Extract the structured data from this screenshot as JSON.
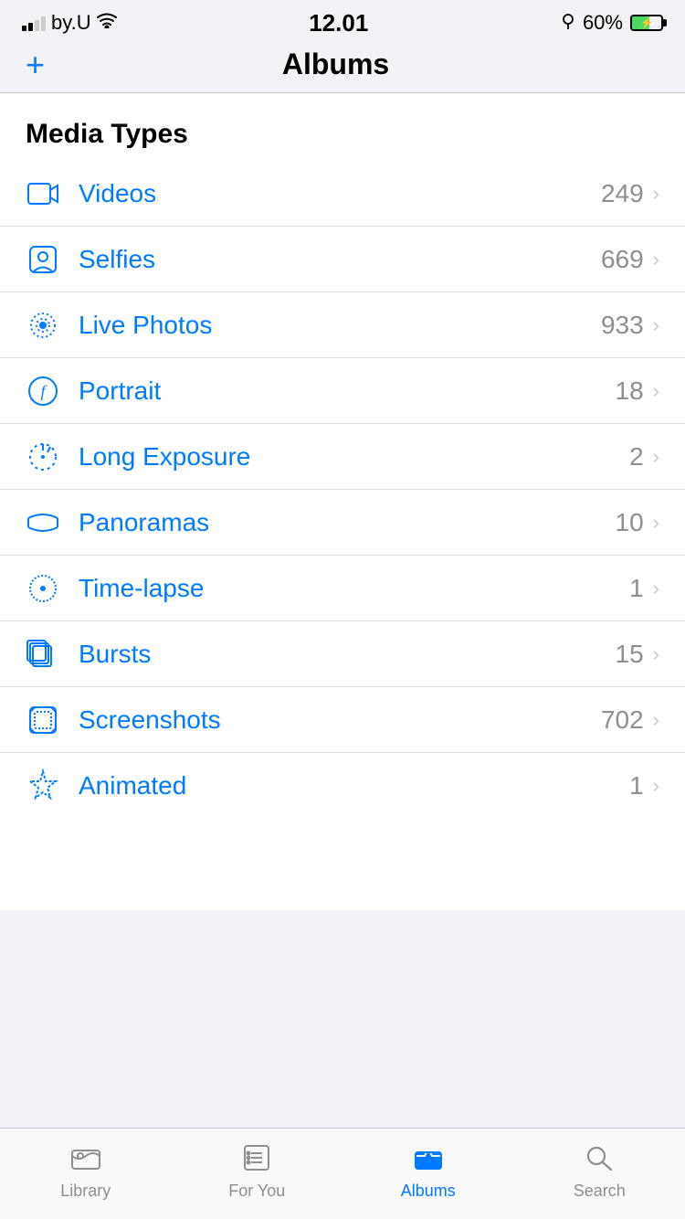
{
  "statusBar": {
    "carrier": "by.U",
    "time": "12.01",
    "batteryPercent": "60%"
  },
  "navBar": {
    "addButton": "+",
    "title": "Albums"
  },
  "mediaSectionHeader": "Media Types",
  "items": [
    {
      "id": "videos",
      "label": "Videos",
      "count": "249",
      "icon": "video"
    },
    {
      "id": "selfies",
      "label": "Selfies",
      "count": "669",
      "icon": "selfie"
    },
    {
      "id": "live-photos",
      "label": "Live Photos",
      "count": "933",
      "icon": "live"
    },
    {
      "id": "portrait",
      "label": "Portrait",
      "count": "18",
      "icon": "portrait"
    },
    {
      "id": "long-exposure",
      "label": "Long Exposure",
      "count": "2",
      "icon": "longexposure"
    },
    {
      "id": "panoramas",
      "label": "Panoramas",
      "count": "10",
      "icon": "panorama"
    },
    {
      "id": "timelapse",
      "label": "Time-lapse",
      "count": "1",
      "icon": "timelapse"
    },
    {
      "id": "bursts",
      "label": "Bursts",
      "count": "15",
      "icon": "bursts"
    },
    {
      "id": "screenshots",
      "label": "Screenshots",
      "count": "702",
      "icon": "screenshot"
    },
    {
      "id": "animated",
      "label": "Animated",
      "count": "1",
      "icon": "animated"
    }
  ],
  "tabBar": {
    "items": [
      {
        "id": "library",
        "label": "Library",
        "active": false
      },
      {
        "id": "for-you",
        "label": "For You",
        "active": false
      },
      {
        "id": "albums",
        "label": "Albums",
        "active": true
      },
      {
        "id": "search",
        "label": "Search",
        "active": false
      }
    ]
  }
}
